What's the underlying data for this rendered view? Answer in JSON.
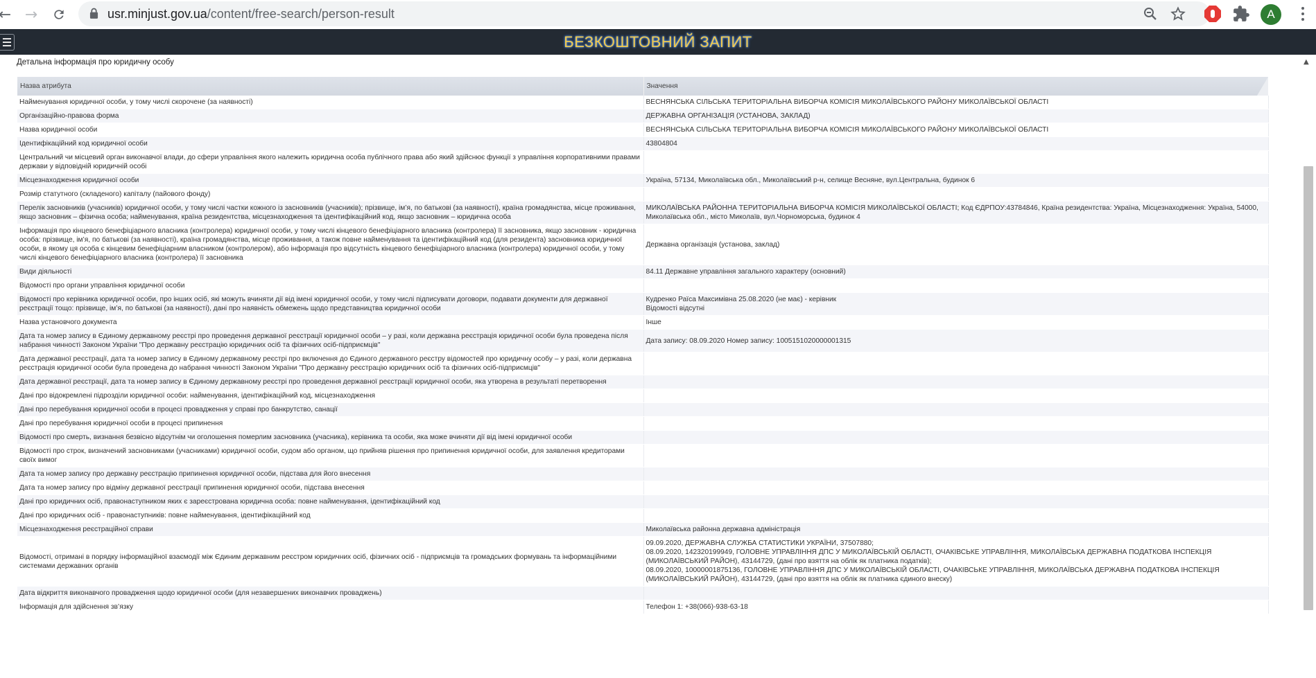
{
  "browser": {
    "url_host": "usr.minjust.gov.ua",
    "url_path": "/content/free-search/person-result",
    "avatar_letter": "A",
    "icons": [
      "back-icon",
      "forward-icon",
      "reload-icon",
      "lock-icon",
      "zoom-icon",
      "star-icon",
      "adblock-icon",
      "puzzle-icon",
      "avatar",
      "menu-icon"
    ]
  },
  "header": {
    "title": "БЕЗКОШТОВНИЙ ЗАПИТ",
    "accent": "#f2c94c",
    "background": "#232a33"
  },
  "section": {
    "title": "Детальна інформація про юридичну особу"
  },
  "table": {
    "headers": [
      "Назва атрибута",
      "Значення"
    ],
    "rows": [
      {
        "name": "Найменування юридичної особи, у тому числі скорочене (за наявності)",
        "value": "ВЕСНЯНСЬКА СІЛЬСЬКА ТЕРИТОРІАЛЬНА ВИБОРЧА КОМІСІЯ МИКОЛАЇВСЬКОГО РАЙОНУ МИКОЛАЇВСЬКОЇ ОБЛАСТІ"
      },
      {
        "name": "Організаційно-правова форма",
        "value": "ДЕРЖАВНА ОРГАНІЗАЦІЯ (УСТАНОВА, ЗАКЛАД)"
      },
      {
        "name": "Назва юридичної особи",
        "value": "ВЕСНЯНСЬКА СІЛЬСЬКА ТЕРИТОРІАЛЬНА ВИБОРЧА КОМІСІЯ МИКОЛАЇВСЬКОГО РАЙОНУ МИКОЛАЇВСЬКОЇ ОБЛАСТІ"
      },
      {
        "name": "Ідентифікаційний код юридичної особи",
        "value": "43804804"
      },
      {
        "name": "Центральний чи місцевий орган виконавчої влади, до сфери управління якого належить юридична особа публічного права або який здійснює функції з управління корпоративними правами держави у відповідній юридичній особі",
        "value": ""
      },
      {
        "name": "Місцезнаходження юридичної особи",
        "value": "Україна, 57134, Миколаївська обл., Миколаївський р-н, селище Весняне, вул.Центральна, будинок 6"
      },
      {
        "name": "Розмір статутного (складеного) капіталу (пайового фонду)",
        "value": ""
      },
      {
        "name": "Перелік засновників (учасників) юридичної особи, у тому числі частки кожного із засновників (учасників); прізвище, ім’я, по батькові (за наявності), країна громадянства, місце проживання, якщо засновник – фізична особа; найменування, країна резидентства, місцезнаходження та ідентифікаційний код, якщо засновник – юридична особа",
        "value": "МИКОЛАЇВСЬКА РАЙОННА ТЕРИТОРІАЛЬНА ВИБОРЧА КОМІСІЯ МИКОЛАЇВСЬКОЇ ОБЛАСТІ; Код ЄДРПОУ:43784846, Країна резидентства: Україна, Місцезнаходження: Україна, 54000, Миколаївська обл., місто Миколаїв, вул.Чорноморська, будинок 4"
      },
      {
        "name": "Інформація про кінцевого бенефіціарного власника (контролера) юридичної особи, у тому числі кінцевого бенефіціарного власника (контролера) її засновника, якщо засновник - юридична особа: прізвище, ім’я, по батькові (за наявності), країна громадянства, місце проживання, а також повне найменування та ідентифікаційний код (для резидента) засновника юридичної особи, в якому ця особа є кінцевим бенефіціарним власником (контролером), або інформація про відсутність кінцевого бенефіціарного власника (контролера) юридичної особи, у тому числі кінцевого бенефіціарного власника (контролера) її засновника",
        "value": "Державна організація (установа, заклад)"
      },
      {
        "name": "Види діяльності",
        "value": "84.11 Державне управління загального характеру (основний)"
      },
      {
        "name": "Відомості про органи управління юридичної особи",
        "value": ""
      },
      {
        "name": "Відомості про керівника юридичної особи, про інших осіб, які можуть вчиняти дії від імені юридичної особи, у тому числі підписувати договори, подавати документи для державної реєстрації тощо: прізвище, ім’я, по батькові (за наявності), дані про наявність обмежень щодо представництва юридичної особи",
        "value": "Кудренко Раїса Максимівна 25.08.2020 (не має) - керівник\nВідомості відсутні"
      },
      {
        "name": "Назва установчого документа",
        "value": "Інше"
      },
      {
        "name": "Дата та номер запису в Єдиному державному реєстрі про проведення державної реєстрації юридичної особи – у разі, коли державна реєстрація юридичної особи була проведена після набрання чинності Законом України \"Про державну реєстрацію юридичних осіб та фізичних осіб-підприємців\"",
        "value": "Дата запису: 08.09.2020 Номер запису: 1005151020000001315"
      },
      {
        "name": "Дата державної реєстрації, дата та номер запису в Єдиному державному реєстрі про включення до Єдиного державного реєстру відомостей про юридичну особу – у разі, коли державна реєстрація юридичної особи була проведена до набрання чинності Законом України \"Про державну реєстрацію юридичних осіб та фізичних осіб-підприємців\"",
        "value": ""
      },
      {
        "name": "Дата державної реєстрації, дата та номер запису в Єдиному державному реєстрі про проведення державної реєстрації юридичної особи, яка утворена в результаті перетворення",
        "value": ""
      },
      {
        "name": "Дані про відокремлені підрозділи юридичної особи: найменування, ідентифікаційний код, місцезнаходження",
        "value": ""
      },
      {
        "name": "Дані про перебування юридичної особи в процесі провадження у справі про банкрутство, санації",
        "value": ""
      },
      {
        "name": "Дані про перебування юридичної особи в процесі припинення",
        "value": ""
      },
      {
        "name": "Відомості про смерть, визнання безвісно відсутнім чи оголошення померлим засновника (учасника), керівника та особи, яка може вчиняти дії від імені юридичної особи",
        "value": ""
      },
      {
        "name": "Відомості про строк, визначений засновниками (учасниками) юридичної особи, судом або органом, що прийняв рішення про припинення юридичної особи, для заявлення кредиторами своїх вимог",
        "value": ""
      },
      {
        "name": "Дата та номер запису про державну реєстрацію припинення юридичної особи, підстава для його внесення",
        "value": ""
      },
      {
        "name": "Дата та номер запису про відміну державної реєстрації припинення юридичної особи, підстава внесення",
        "value": ""
      },
      {
        "name": "Дані про юридичних осіб, правонаступником яких є зареєстрована юридична особа: повне найменування, ідентифікаційний код",
        "value": ""
      },
      {
        "name": "Дані про юридичних осіб - правонаступників: повне найменування, ідентифікаційний код",
        "value": ""
      },
      {
        "name": "Місцезнаходження реєстраційної справи",
        "value": "Миколаївська районна державна адміністрація"
      },
      {
        "name": "Відомості, отримані в порядку інформаційної взаємодії між Єдиним державним реєстром юридичних осіб, фізичних осіб - підприємців та громадських формувань та інформаційними системами державних органів",
        "value": "09.09.2020, ДЕРЖАВНА СЛУЖБА СТАТИСТИКИ УКРАЇНИ, 37507880;\n08.09.2020, 142320199949, ГОЛОВНЕ УПРАВЛІННЯ ДПС У МИКОЛАЇВСЬКІЙ ОБЛАСТІ, ОЧАКІВСЬКЕ УПРАВЛІННЯ, МИКОЛАЇВСЬКА ДЕРЖАВНА ПОДАТКОВА ІНСПЕКЦІЯ (МИКОЛАЇВСЬКИЙ РАЙОН), 43144729, (дані про взяття на облік як платника податків);\n08.09.2020, 10000001875136, ГОЛОВНЕ УПРАВЛІННЯ ДПС У МИКОЛАЇВСЬКІЙ ОБЛАСТІ, ОЧАКІВСЬКЕ УПРАВЛІННЯ, МИКОЛАЇВСЬКА ДЕРЖАВНА ПОДАТКОВА ІНСПЕКЦІЯ (МИКОЛАЇВСЬКИЙ РАЙОН), 43144729, (дані про взяття на облік як платника єдиного внеску)"
      },
      {
        "name": "Дата відкриття виконавчого провадження щодо юридичної особи (для незавершених виконавчих проваджень)",
        "value": ""
      },
      {
        "name": "Інформація для здійснення зв’язку",
        "value": "Телефон 1: +38(066)-938-63-18"
      }
    ]
  }
}
